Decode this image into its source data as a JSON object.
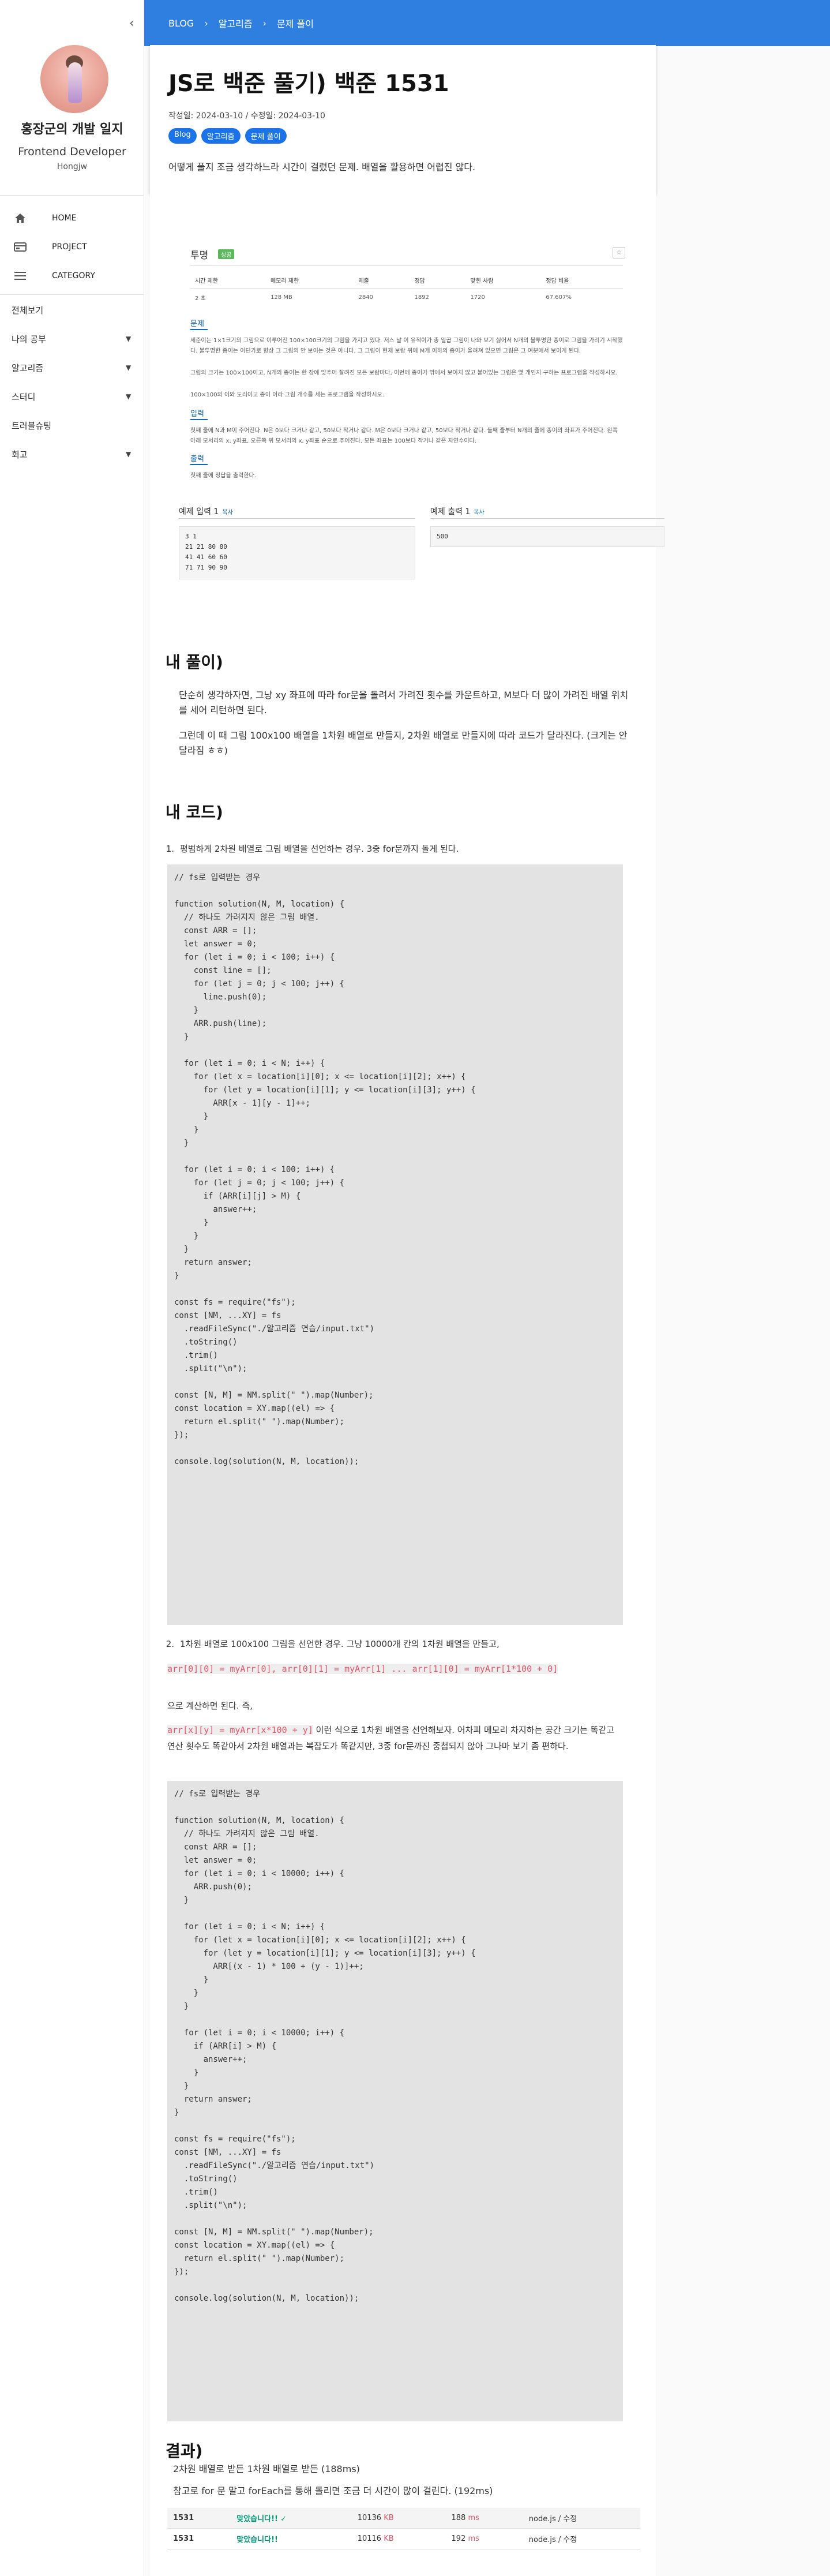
{
  "sidebar": {
    "collapse_icon": "chevron-left-icon",
    "site_title": "홍장군의 개발 일지",
    "role": "Frontend Developer",
    "username": "Hongjw",
    "nav": [
      {
        "icon": "home-icon",
        "label": "HOME"
      },
      {
        "icon": "project-icon",
        "label": "PROJECT"
      },
      {
        "icon": "menu-icon",
        "label": "CATEGORY"
      }
    ],
    "categories": [
      {
        "label": "전체보기",
        "expandable": false
      },
      {
        "label": "나의 공부",
        "expandable": true
      },
      {
        "label": "알고리즘",
        "expandable": true
      },
      {
        "label": "스터디",
        "expandable": true
      },
      {
        "label": "트러블슈팅",
        "expandable": false
      },
      {
        "label": "회고",
        "expandable": true
      }
    ]
  },
  "breadcrumb": [
    "BLOG",
    "알고리즘",
    "문제 풀이"
  ],
  "post": {
    "title": "JS로 백준 풀기) 백준 1531",
    "dates": "작성일: 2024-03-10 / 수정일: 2024-03-10",
    "tags": [
      "Blog",
      "알고리즘",
      "문제 풀이"
    ],
    "description": "어떻게 풀지 조금 생각하느라 시간이 걸렸던 문제. 배열을 활용하면 어렵진 않다."
  },
  "problem": {
    "title": "투명",
    "badge": "성공",
    "star": "☆",
    "table_headers": [
      "시간 제한",
      "메모리 제한",
      "제출",
      "정답",
      "맞힌 사람",
      "정답 비율"
    ],
    "table_values": [
      "2 초",
      "128 MB",
      "2840",
      "1892",
      "1720",
      "67.607%"
    ],
    "sec_problem": "문제",
    "problem_text": "세준이는 1×1크기의 그림으로 이루어진 100×100크기의 그림을 가지고 있다. 저스 날 이 유적이가 총 일곱 그림이 나와 보기 싫어서 N개의 불투명한 종이로 그림을 가리기 시작했다. 불투명한 종이는 어딘가로 향상 그 그림의 안 보이는 것은 아니다. 그 그림이 현재 보람 위에 M개 이하의 종이가 올려져 있으면 그림은 그 여분에서 보이게 된다.",
    "problem_text2": "그림의 크기는 100×100이고, N개의 종이는 한 장에 맞추어 잘려진 모든 보람마다, 이번에 종이가 밖에서 보이지 않고 붙어있는 그림은 몇 개인지 구하는 프로그램을 작성하시오.",
    "problem_text3": "100×100의 이와 도리이고 종이 이라 그림 개수를 세는 프로그램을 작성하시오.",
    "sec_input": "입력",
    "input_text": "첫째 줄에 N과 M이 주어진다. N은 0보다 크거나 같고, 50보다 작거나 같다. M은 0보다 크거나 같고, 50보다 작거나 같다. 둘째 줄부터 N개의 줄에 종이의 좌표가 주어진다. 왼쪽 아래 모서리의 x, y좌표, 오른쪽 위 모서리의 x, y좌표 순으로 주어진다. 모든 좌표는 100보다 작거나 같은 자연수이다.",
    "sec_output": "출력",
    "output_text": "첫째 줄에 정답을 출력한다.",
    "sample_in_label": "예제 입력 1",
    "sample_out_label": "예제 출력 1",
    "copy_label": "복사",
    "sample_in": "3 1\n21 21 80 80\n41 41 60 60\n71 71 90 90",
    "sample_out": "500"
  },
  "sections": {
    "approach_title": "내 풀이)",
    "approach_p1": "단순히 생각하자면, 그냥 xy 좌표에 따라 for문을 돌려서 가려진 횟수를 카운트하고, M보다 더 많이 가려진 배열 위치를 세어 리턴하면 된다.",
    "approach_p2": "그런데 이 때 그림 100x100 배열을 1차원 배열로 만들지, 2차원 배열로 만들지에 따라 코드가 달라진다. (크게는 안달라짐 ㅎㅎ)",
    "code_title": "내 코드)",
    "item1_num": "1.",
    "item1": "평범하게 2차원 배열로 그림 배열을 선언하는 경우. 3중 for문까지 돌게 된다.",
    "code1": "// fs로 입력받는 경우\n\nfunction solution(N, M, location) {\n  // 하나도 가려지지 않은 그림 배열.\n  const ARR = [];\n  let answer = 0;\n  for (let i = 0; i < 100; i++) {\n    const line = [];\n    for (let j = 0; j < 100; j++) {\n      line.push(0);\n    }\n    ARR.push(line);\n  }\n\n  for (let i = 0; i < N; i++) {\n    for (let x = location[i][0]; x <= location[i][2]; x++) {\n      for (let y = location[i][1]; y <= location[i][3]; y++) {\n        ARR[x - 1][y - 1]++;\n      }\n    }\n  }\n\n  for (let i = 0; i < 100; i++) {\n    for (let j = 0; j < 100; j++) {\n      if (ARR[i][j] > M) {\n        answer++;\n      }\n    }\n  }\n  return answer;\n}\n\nconst fs = require(\"fs\");\nconst [NM, ...XY] = fs\n  .readFileSync(\"./알고리즘 연습/input.txt\")\n  .toString()\n  .trim()\n  .split(\"\\n\");\n\nconst [N, M] = NM.split(\" \").map(Number);\nconst location = XY.map((el) => {\n  return el.split(\" \").map(Number);\n});\n\nconsole.log(solution(N, M, location));",
    "item2_num": "2.",
    "item2": "1차원 배열로 100x100 그림을 선언한 경우. 그냥 10000개 칸의 1차원 배열을 만들고,",
    "item2_code": "arr[0][0] = myArr[0], arr[0][1] = myArr[1] ... arr[1][0] = myArr[1*100 + 0]",
    "item2_after": "으로 계산하면 된다. 즉,",
    "item2_code2": "arr[x][y] = myArr[x*100 + y]",
    "item2_after2": " 이런 식으로 1차원 배열을 선언해보자. 어차피 메모리 차지하는 공간 크기는 똑같고 연산 횟수도 똑같아서 2차원 배열과는 복잡도가 똑같지만, 3중 for문까진 중첩되지 않아 그나마 보기 좀 편하다.",
    "code2": "// fs로 입력받는 경우\n\nfunction solution(N, M, location) {\n  // 하나도 가려지지 않은 그림 배열.\n  const ARR = [];\n  let answer = 0;\n  for (let i = 0; i < 10000; i++) {\n    ARR.push(0);\n  }\n\n  for (let i = 0; i < N; i++) {\n    for (let x = location[i][0]; x <= location[i][2]; x++) {\n      for (let y = location[i][1]; y <= location[i][3]; y++) {\n        ARR[(x - 1) * 100 + (y - 1)]++;\n      }\n    }\n  }\n\n  for (let i = 0; i < 10000; i++) {\n    if (ARR[i] > M) {\n      answer++;\n    }\n  }\n  return answer;\n}\n\nconst fs = require(\"fs\");\nconst [NM, ...XY] = fs\n  .readFileSync(\"./알고리즘 연습/input.txt\")\n  .toString()\n  .trim()\n  .split(\"\\n\");\n\nconst [N, M] = NM.split(\" \").map(Number);\nconst location = XY.map((el) => {\n  return el.split(\" \").map(Number);\n});\n\nconsole.log(solution(N, M, location));",
    "result_title": "결과)",
    "result_p1": "2차원 배열로 받든 1차원 배열로 받든 (188ms)",
    "result_p2": "참고로 for 문 말고 forEach를 통해 돌리면 조금 더 시간이 많이 걸린다. (192ms)"
  },
  "results": [
    {
      "id": "1531",
      "status": "맞았습니다!!",
      "check": "✓",
      "memory": "10136",
      "mem_unit": "KB",
      "time": "188",
      "time_unit": "ms",
      "lang": "node.js / 수정"
    },
    {
      "id": "1531",
      "status": "맞았습니다!!",
      "check": "",
      "memory": "10116",
      "mem_unit": "KB",
      "time": "192",
      "time_unit": "ms",
      "lang": "node.js / 수정"
    }
  ]
}
